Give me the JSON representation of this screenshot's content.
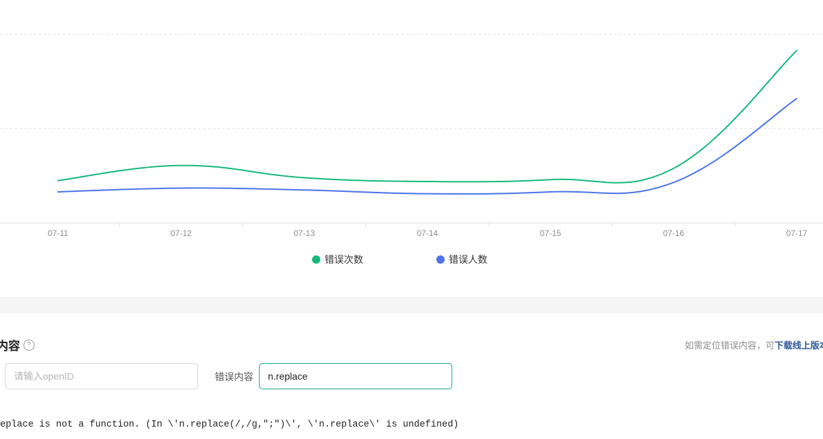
{
  "chart_data": {
    "type": "line",
    "x": [
      "07-11",
      "07-12",
      "07-13",
      "07-14",
      "07-15",
      "07-16",
      "07-17"
    ],
    "series": [
      {
        "name": "错误次数",
        "color": "#14b97a",
        "values": [
          45,
          61,
          48,
          44,
          46,
          58,
          183
        ]
      },
      {
        "name": "错误人数",
        "color": "#4a74e8",
        "values": [
          33,
          37,
          35,
          31,
          33,
          43,
          132
        ]
      }
    ],
    "ylim": [
      0,
      200
    ],
    "grid": true,
    "legend": "bottom"
  },
  "section": {
    "title": "内容",
    "hint_prefix": "如需定位错误内容，可",
    "hint_link": "下载线上版本 S"
  },
  "filters": {
    "openid_placeholder": "请输入openID",
    "content_label": "错误内容",
    "content_value": "n.replace"
  },
  "error_message": "replace is not a function. (In \\'n.replace(/,/g,\";\")\\', \\'n.replace\\' is undefined)"
}
